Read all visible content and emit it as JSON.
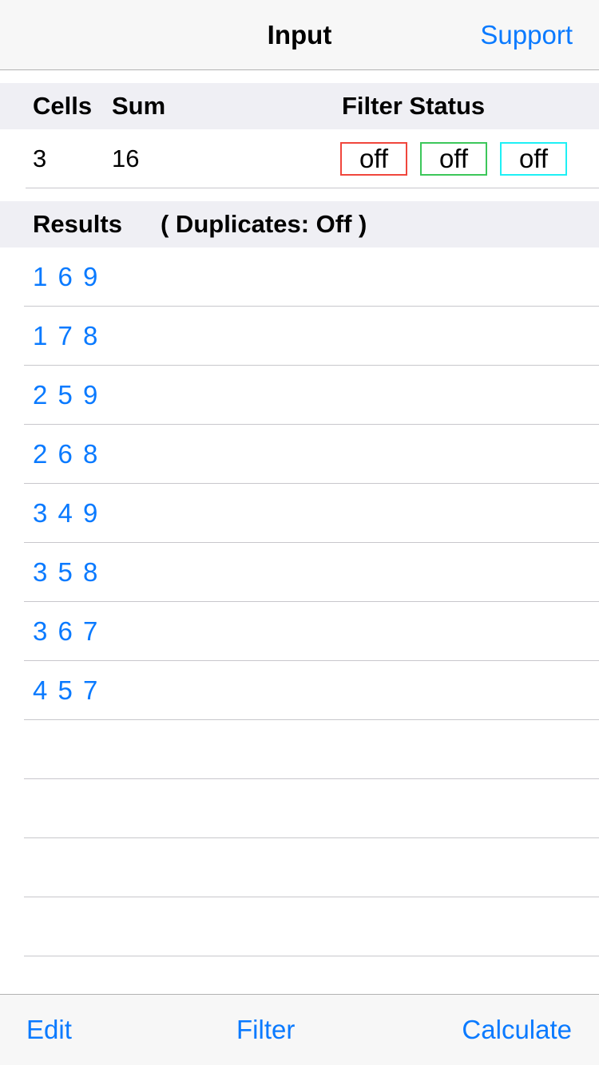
{
  "navbar": {
    "title": "Input",
    "right_button": "Support"
  },
  "info_header": {
    "cells_label": "Cells",
    "sum_label": "Sum",
    "filter_status_label": "Filter Status"
  },
  "info_values": {
    "cells": "3",
    "sum": "16",
    "filters": [
      {
        "label": "off",
        "color": "#f0463c"
      },
      {
        "label": "off",
        "color": "#3cc75a"
      },
      {
        "label": "off",
        "color": "#1ef0f5"
      }
    ]
  },
  "results_header": {
    "title": "Results",
    "duplicates": "( Duplicates:  Off )"
  },
  "results": [
    "1 6 9",
    "1 7 8",
    "2 5 9",
    "2 6 8",
    "3 4 9",
    "3 5 8",
    "3 6 7",
    "4 5 7",
    "",
    "",
    "",
    "",
    ""
  ],
  "toolbar": {
    "edit": "Edit",
    "filter": "Filter",
    "calculate": "Calculate"
  },
  "colors": {
    "accent": "#0a7aff",
    "section_bg": "#efeff4",
    "bar_bg": "#f7f7f7"
  }
}
